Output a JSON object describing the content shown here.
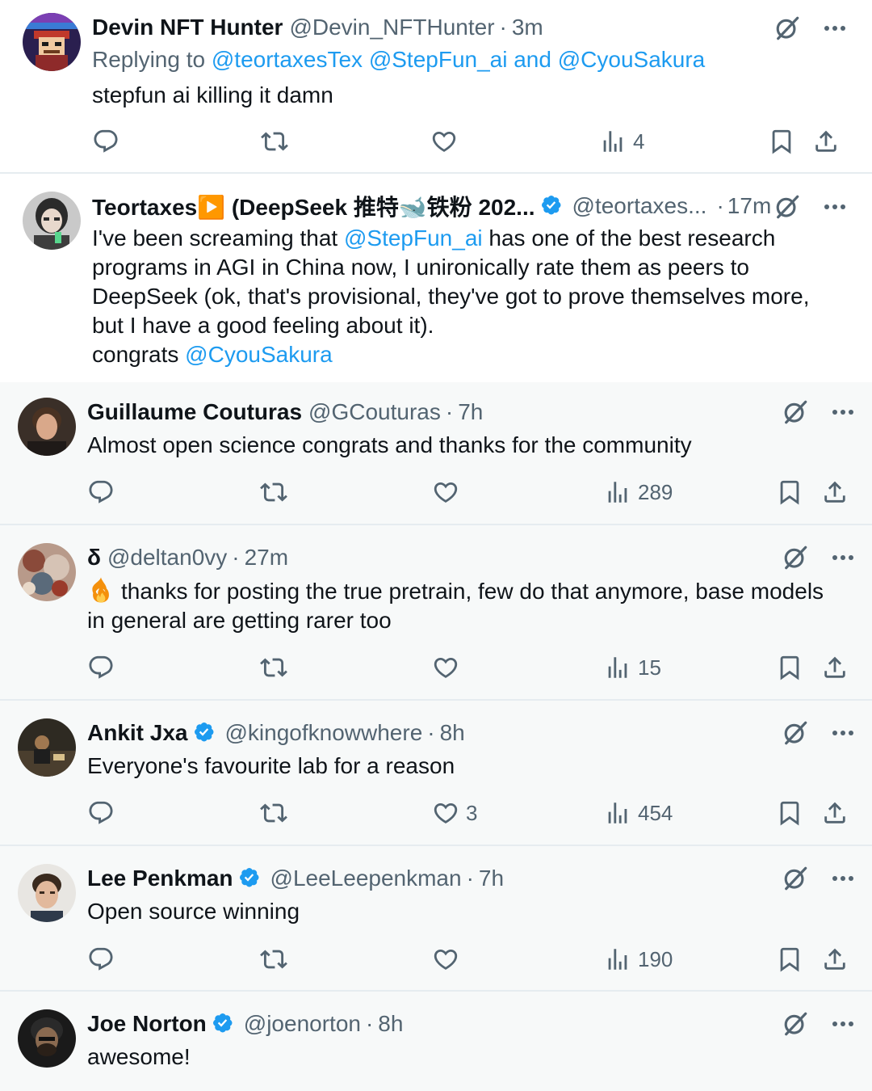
{
  "tweets": [
    {
      "name": "Devin NFT Hunter",
      "handle": "@Devin_NFTHunter",
      "time": "3m",
      "replying_prefix": "Replying to",
      "replying_links": "@teortaxesTex @StepFun_ai and @CyouSakura",
      "text": "stepfun ai killing it damn",
      "views": "4",
      "likes": "",
      "icons": [
        "reply-icon",
        "retweet-icon",
        "like-icon",
        "views-icon",
        "bookmark-icon",
        "share-icon"
      ]
    },
    {
      "name": "Teortaxes▶️ (DeepSeek 推特🐋铁粉 202...",
      "handle": "@teortaxes...",
      "time": "17m",
      "verified": true,
      "text_before": "I've been screaming that ",
      "text_mention1": "@StepFun_ai",
      "text_middle": " has one of the best research programs in AGI in China now, I unironically rate them as peers to DeepSeek (ok, that's provisional, they've got to prove themselves more, but I have a good feeling about it).",
      "text_congrats": "congrats ",
      "text_mention2": "@CyouSakura"
    },
    {
      "name": "Guillaume Couturas",
      "handle": "@GCouturas",
      "time": "7h",
      "text": "Almost open science congrats and thanks for the community",
      "views": "289"
    },
    {
      "name": "δ",
      "handle": "@deltan0vy",
      "time": "27m",
      "text": "thanks for posting the true pretrain, few do that anymore, base models in general are getting rarer too",
      "emoji": "fire-emoji",
      "views": "15"
    },
    {
      "name": "Ankit Jxa",
      "handle": "@kingofknowwhere",
      "time": "8h",
      "verified": true,
      "text": "Everyone's favourite lab for a reason",
      "likes": "3",
      "views": "454"
    },
    {
      "name": "Lee Penkman",
      "handle": "@LeeLeepenkman",
      "time": "7h",
      "verified": true,
      "text": "Open source winning",
      "views": "190"
    },
    {
      "name": "Joe Norton",
      "handle": "@joenorton",
      "time": "8h",
      "verified": true,
      "text": "awesome!"
    }
  ],
  "separator": "·",
  "colors": {
    "link": "#1d9bf0",
    "muted": "#536471",
    "text": "#0f1419",
    "shaded_bg": "#f7f9f9",
    "divider": "#e6ecf0",
    "verified": "#1d9bf0"
  }
}
